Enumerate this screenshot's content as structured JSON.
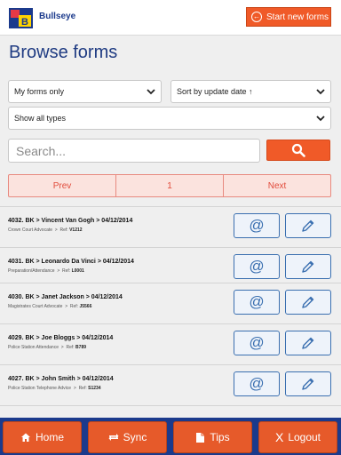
{
  "header": {
    "brand": "Bullseye",
    "start_button": "Start new forms",
    "logo_letters": "B"
  },
  "page_title": "Browse forms",
  "filters": {
    "owner": "My forms only",
    "sort": "Sort by update date ↑",
    "types": "Show all types"
  },
  "search": {
    "placeholder": "Search..."
  },
  "pager": {
    "prev": "Prev",
    "page": "1",
    "next": "Next"
  },
  "forms": [
    {
      "title": "4032. BK  >  Vincent Van Gogh  >  04/12/2014",
      "type": "Crown Court Advocate",
      "ref_label": "Ref:",
      "ref": "V1212"
    },
    {
      "title": "4031. BK  >  Leonardo Da Vinci  >  04/12/2014",
      "type": "Preparation/Attendance",
      "ref_label": "Ref:",
      "ref": "L0001"
    },
    {
      "title": "4030. BK  >  Janet Jackson  >  04/12/2014",
      "type": "Magistrates Court Advocate",
      "ref_label": "Ref:",
      "ref": "J5566"
    },
    {
      "title": "4029. BK  >  Joe Bloggs  >  04/12/2014",
      "type": "Police Station Attendance",
      "ref_label": "Ref:",
      "ref": "B789"
    },
    {
      "title": "4027. BK  >  John Smith  >  04/12/2014",
      "type": "Police Station Telephone Advice",
      "ref_label": "Ref:",
      "ref": "S1234"
    }
  ],
  "row_actions": {
    "email_symbol": "@",
    "edit_icon": "pencil-icon"
  },
  "bottom_nav": {
    "home": "Home",
    "sync": "Sync",
    "tips": "Tips",
    "logout": "Logout",
    "logout_glyph": "X"
  },
  "colors": {
    "accent": "#f05a28",
    "brand_blue": "#1b3a8c",
    "link_blue": "#3a6fb0",
    "pager_text": "#e14b3b",
    "pager_bg": "#fbe3de"
  }
}
